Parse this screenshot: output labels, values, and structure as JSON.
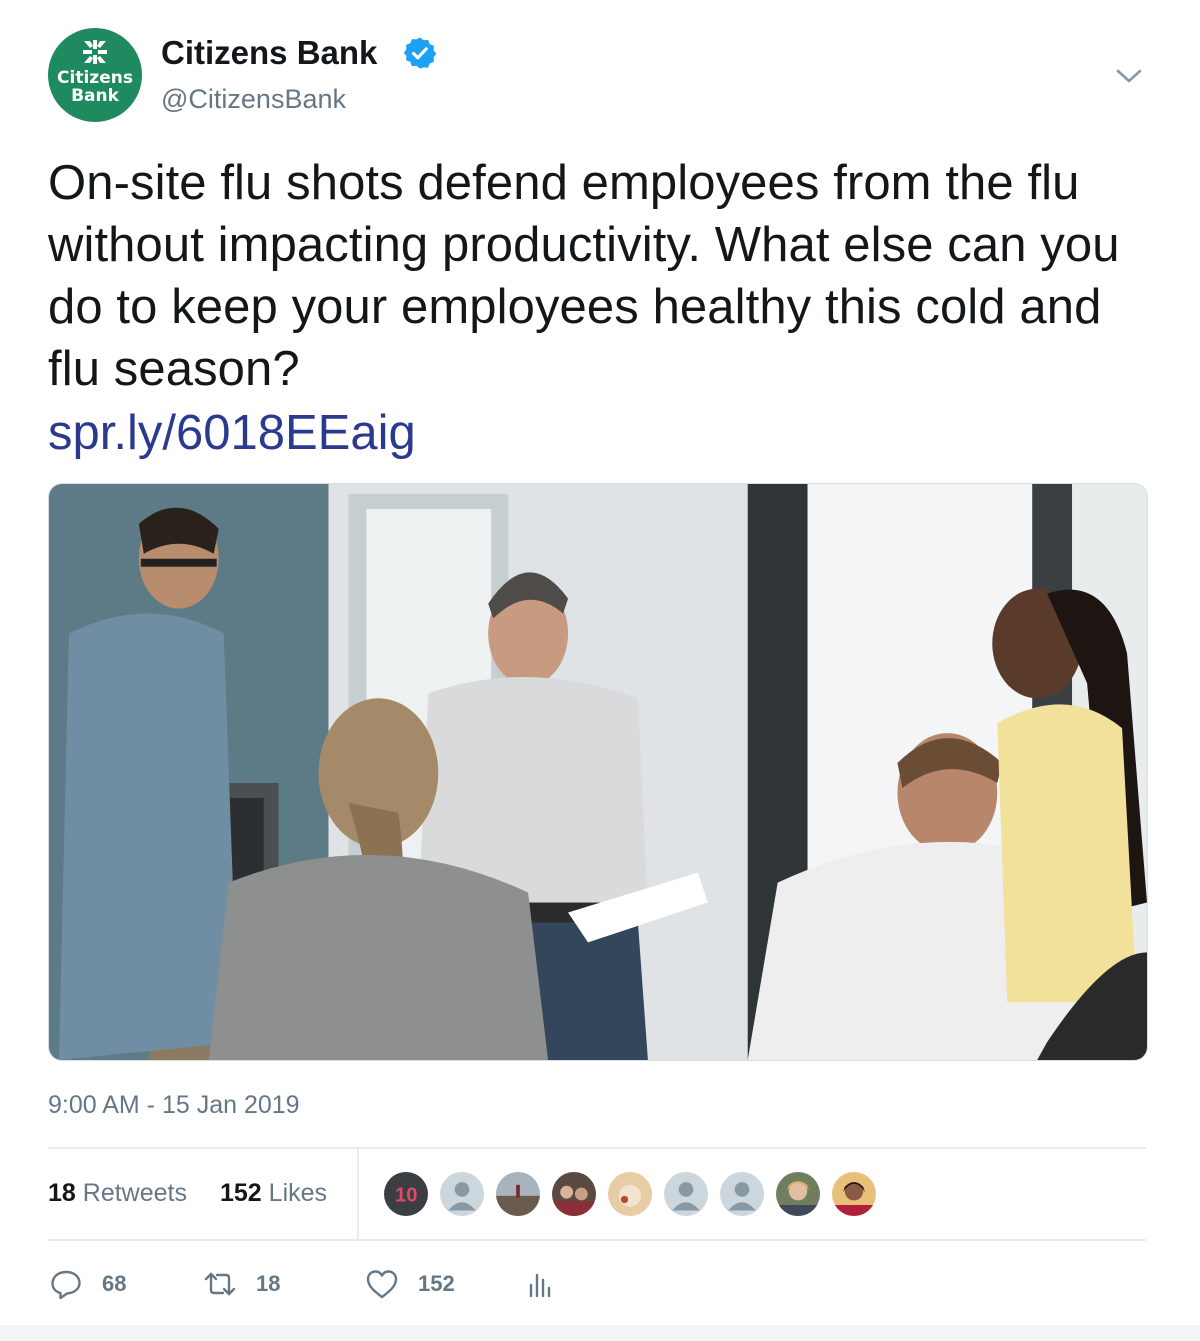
{
  "author": {
    "name": "Citizens Bank",
    "handle": "@CitizensBank",
    "verified": true,
    "avatar_text_line1": "Citizens",
    "avatar_text_line2": "Bank",
    "avatar_color": "#1f8a60"
  },
  "tweet": {
    "text": "On-site flu shots defend employees from the flu without impacting productivity. What else can you do to keep your employees healthy this cold and flu season?",
    "link": "spr.ly/6018EEaig",
    "link_color": "#2b3a8f",
    "timestamp": "9:00 AM - 15 Jan 2019"
  },
  "stats": {
    "retweets_count": "18",
    "retweets_label": "Retweets",
    "likes_count": "152",
    "likes_label": "Likes",
    "likers": [
      "liker-10",
      "default",
      "beach",
      "group",
      "food",
      "default",
      "default",
      "woman-blonde",
      "woman-dark"
    ]
  },
  "actions": {
    "reply_count": "68",
    "retweet_count": "18",
    "like_count": "152",
    "icons": [
      "reply-icon",
      "retweet-icon",
      "heart-icon",
      "analytics-icon"
    ]
  },
  "colors": {
    "text": "#14171a",
    "secondary": "#657786",
    "verified": "#1da1f2",
    "divider": "#e6ecf0"
  }
}
